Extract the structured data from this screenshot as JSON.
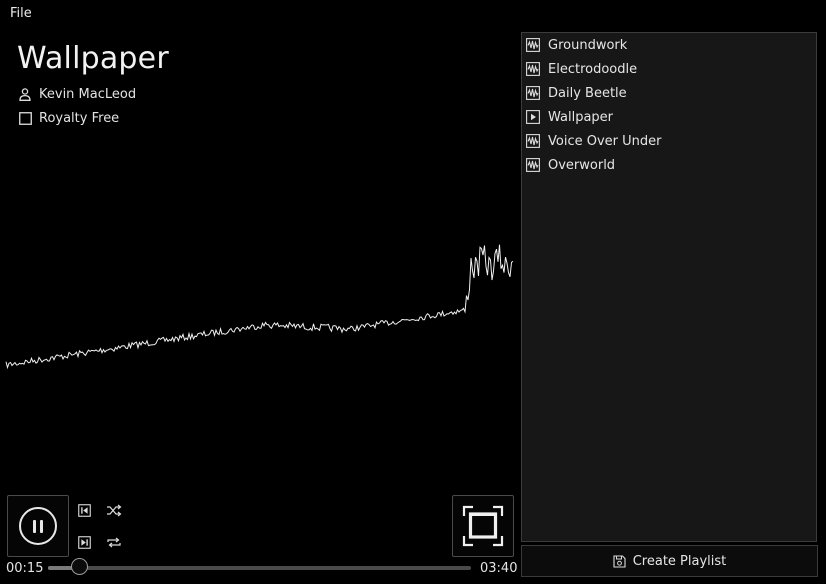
{
  "menu": {
    "file_label": "File"
  },
  "now_playing": {
    "title": "Wallpaper",
    "artist": "Kevin MacLeod",
    "license": "Royalty Free",
    "elapsed": "00:15",
    "duration": "03:40",
    "progress": 0.068
  },
  "icons": {
    "artist": "person-icon",
    "license": "square-icon",
    "play_pause": "pause-icon",
    "previous": "skip-previous-icon",
    "next": "skip-next-icon",
    "shuffle": "shuffle-icon",
    "repeat": "repeat-icon",
    "fullscreen": "fullscreen-icon",
    "playlist_track": "waveform-icon",
    "playlist_current": "play-icon",
    "create_playlist": "save-icon"
  },
  "playlist": {
    "items": [
      {
        "label": "Groundwork",
        "icon": "waveform-icon",
        "current": false
      },
      {
        "label": "Electrodoodle",
        "icon": "waveform-icon",
        "current": false
      },
      {
        "label": "Daily Beetle",
        "icon": "waveform-icon",
        "current": false
      },
      {
        "label": "Wallpaper",
        "icon": "play-icon",
        "current": true
      },
      {
        "label": "Voice Over Under",
        "icon": "waveform-icon",
        "current": false
      },
      {
        "label": "Overworld",
        "icon": "waveform-icon",
        "current": false
      }
    ],
    "create_label": "Create Playlist"
  },
  "colors": {
    "background": "#000000",
    "panel": "#171717",
    "text": "#e8e8e8",
    "border": "#3c3c3c"
  }
}
